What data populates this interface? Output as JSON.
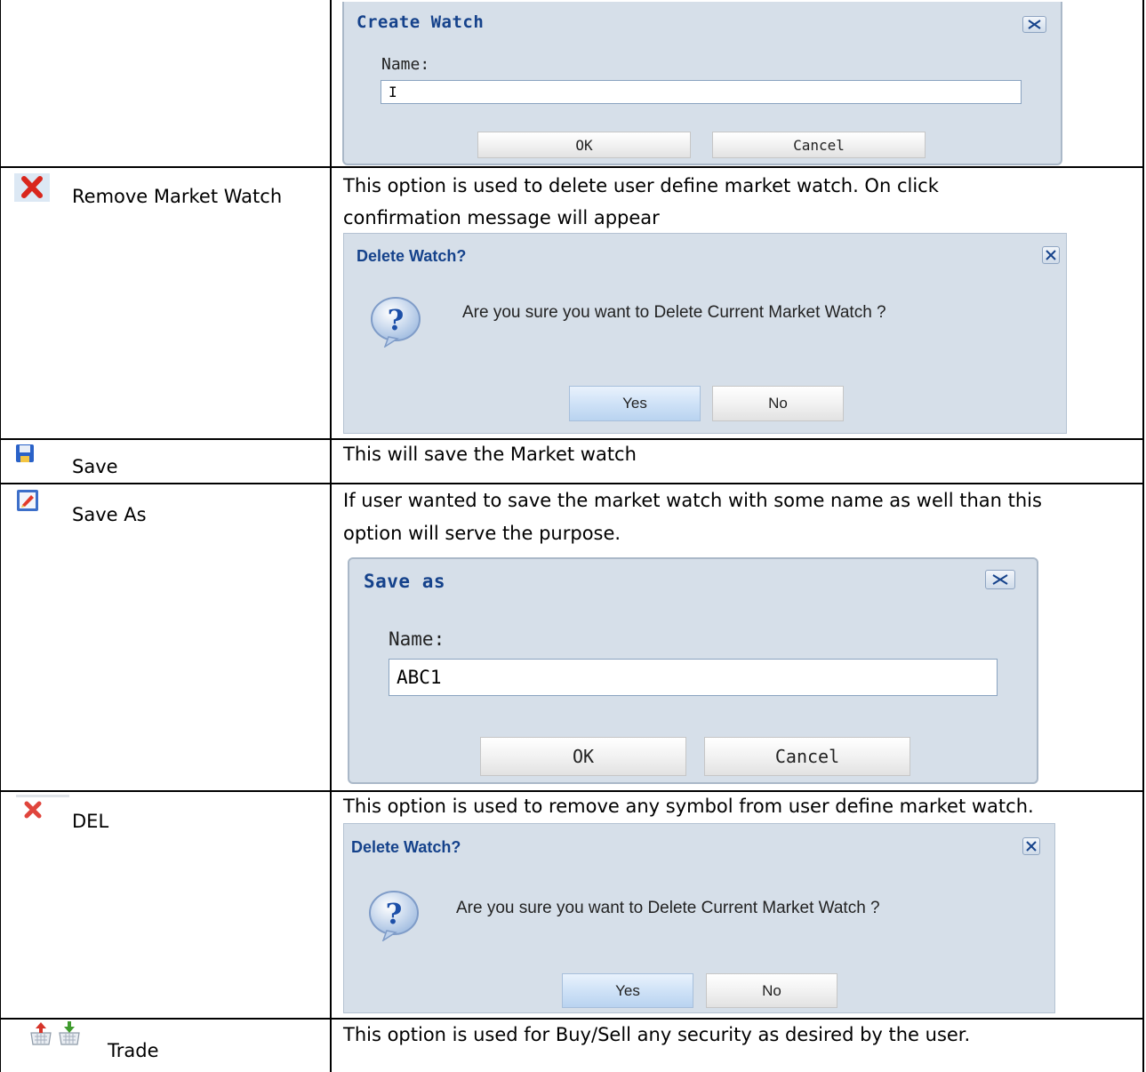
{
  "rows": [
    {
      "option": "",
      "description": ""
    },
    {
      "option": "Remove Market Watch",
      "icon": "red-x-icon",
      "description_lines": [
        "This option is used to delete user define market watch. On click",
        "confirmation message will appear"
      ]
    },
    {
      "option": "Save",
      "icon": "floppy-disk-icon",
      "description": "This will save the Market watch"
    },
    {
      "option": "Save As",
      "icon": "save-as-icon",
      "description_lines": [
        "If user wanted to save the market watch with some name as well than this",
        "option will serve the purpose."
      ]
    },
    {
      "option": "DEL",
      "icon": "red-x-icon",
      "description": "This option is used to remove any symbol from user define market watch."
    },
    {
      "option": "Trade",
      "icon": "buy-sell-icons",
      "description": "This option is used for Buy/Sell any security as desired by the user."
    }
  ],
  "dialogs": {
    "create_watch": {
      "title": "Create Watch",
      "label": "Name:",
      "input_value": "I",
      "ok": "OK",
      "cancel": "Cancel"
    },
    "delete_watch_1": {
      "title": "Delete Watch?",
      "message": "Are you sure you want to Delete Current Market Watch ?",
      "yes": "Yes",
      "no": "No"
    },
    "save_as": {
      "title": "Save as",
      "label": "Name:",
      "input_value": "ABC1",
      "ok": "OK",
      "cancel": "Cancel"
    },
    "delete_watch_2": {
      "title": "Delete Watch?",
      "message": "Are you sure you want to Delete Current Market Watch ?",
      "yes": "Yes",
      "no": "No"
    }
  },
  "colors": {
    "dialog_bg": "#d6dfe9",
    "title": "#15428b",
    "red_x": "#d9261c",
    "question_blue": "#1c4fa8"
  }
}
